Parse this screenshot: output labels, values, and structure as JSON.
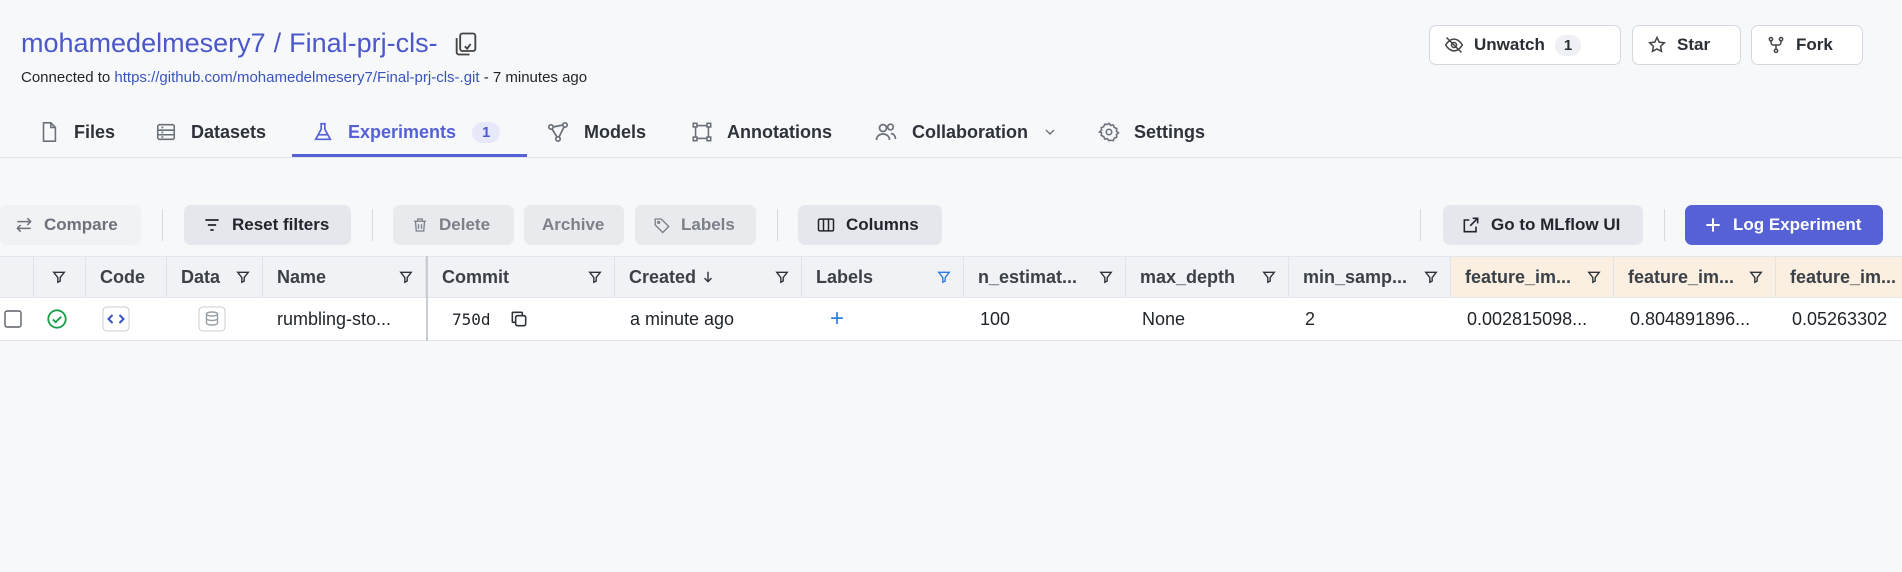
{
  "repo": {
    "owner": "mohamedelmesery7",
    "separator": "/",
    "name": "Final-prj-cls-",
    "connected_prefix": "Connected to",
    "connected_url": "https://github.com/mohamedelmesery7/Final-prj-cls-.git",
    "connected_suffix": "- 7 minutes ago"
  },
  "header_actions": {
    "unwatch_label": "Unwatch",
    "unwatch_count": "1",
    "star_label": "Star",
    "fork_label": "Fork"
  },
  "tabs": [
    {
      "label": "Files",
      "icon": "file-icon"
    },
    {
      "label": "Datasets",
      "icon": "dataset-icon"
    },
    {
      "label": "Experiments",
      "icon": "flask-icon",
      "badge": "1",
      "active": true
    },
    {
      "label": "Models",
      "icon": "models-icon"
    },
    {
      "label": "Annotations",
      "icon": "annotations-icon"
    },
    {
      "label": "Collaboration",
      "icon": "users-icon"
    },
    {
      "label": "Settings",
      "icon": "gear-icon"
    }
  ],
  "toolbar": {
    "compare": "Compare",
    "reset_filters": "Reset filters",
    "delete": "Delete",
    "archive": "Archive",
    "labels": "Labels",
    "columns": "Columns",
    "mlflow": "Go to MLflow UI",
    "log_experiment": "Log Experiment"
  },
  "table": {
    "headers": {
      "code": "Code",
      "data": "Data",
      "name": "Name",
      "commit": "Commit",
      "created": "Created",
      "labels": "Labels",
      "n_estimators": "n_estimat...",
      "max_depth": "max_depth",
      "min_samples": "min_samp...",
      "feature1": "feature_im...",
      "feature2": "feature_im...",
      "feature3": "feature_im..."
    },
    "rows": [
      {
        "name": "rumbling-sto...",
        "commit": "750d",
        "created": "a minute ago",
        "labels_add": "+",
        "n_estimators": "100",
        "max_depth": "None",
        "min_samples": "2",
        "feature1": "0.002815098...",
        "feature2": "0.804891896...",
        "feature3": "0.05263302"
      }
    ]
  },
  "colors": {
    "accent": "#5561d4",
    "link": "#3a53c0",
    "feature_header_bg": "#fbefe2",
    "success": "#1a9e4a"
  }
}
